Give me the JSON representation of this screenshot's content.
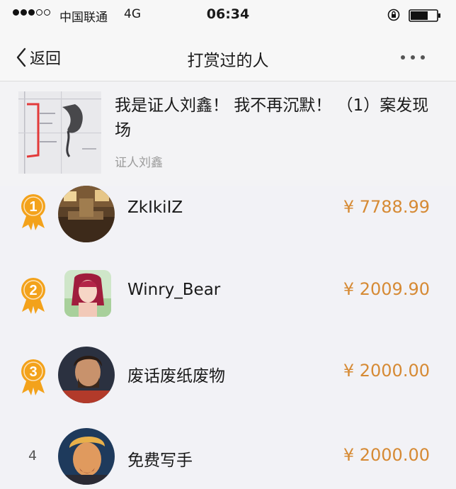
{
  "status_bar": {
    "carrier": "中国联通",
    "network": "4G",
    "time": "06:34",
    "signal_bars_filled": 3,
    "signal_bars_total": 5
  },
  "nav": {
    "back_label": "返回",
    "title": "打赏过的人",
    "more_icon": "more-dots-icon"
  },
  "article": {
    "title": "我是证人刘鑫！ 我不再沉默！ （1）案发现场",
    "author": "证人刘鑫"
  },
  "tippers": [
    {
      "rank": "1",
      "name": "ZkIkiIZ",
      "amount": "¥ 7788.99",
      "medal": "gold-medal-icon"
    },
    {
      "rank": "2",
      "name": "Winry_Bear",
      "amount": "¥ 2009.90",
      "medal": "silver-medal-icon"
    },
    {
      "rank": "3",
      "name": "废话废纸废物",
      "amount": "¥ 2000.00",
      "medal": "bronze-medal-icon"
    },
    {
      "rank": "4",
      "name": "免费写手",
      "amount": "¥ 2000.00"
    }
  ],
  "colors": {
    "amount": "#d68a34",
    "medal_orange": "#f3a21b",
    "background": "#f2f2f6"
  }
}
